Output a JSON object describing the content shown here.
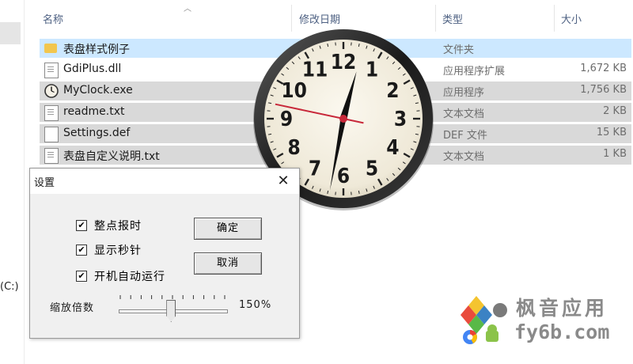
{
  "explorer": {
    "columns": {
      "name": "名称",
      "modified": "修改日期",
      "type": "类型",
      "size": "大小"
    },
    "rows": [
      {
        "name": "表盘样式例子",
        "type": "文件夹",
        "size": "",
        "icon": "folder-icon"
      },
      {
        "name": "GdiPlus.dll",
        "type": "应用程序扩展",
        "size": "1,672 KB",
        "icon": "dll-file-icon"
      },
      {
        "name": "MyClock.exe",
        "type": "应用程序",
        "size": "1,756 KB",
        "icon": "clock-app-icon"
      },
      {
        "name": "readme.txt",
        "type": "文本文档",
        "size": "2 KB",
        "icon": "text-file-icon"
      },
      {
        "name": "Settings.def",
        "type": "DEF 文件",
        "size": "15 KB",
        "icon": "generic-file-icon"
      },
      {
        "name": "表盘自定义说明.txt",
        "type": "文本文档",
        "size": "1 KB",
        "icon": "text-file-icon"
      }
    ],
    "nav_drive_label": "(C:)"
  },
  "clock": {
    "numerals": [
      "12",
      "1",
      "2",
      "3",
      "4",
      "5",
      "6",
      "7",
      "8",
      "9",
      "10",
      "11"
    ],
    "time": {
      "hour": 12,
      "minute": 31,
      "second": 47
    }
  },
  "settings_dialog": {
    "title": "设置",
    "close_glyph": "✕",
    "options": [
      {
        "label": "整点报时",
        "checked": true
      },
      {
        "label": "显示秒针",
        "checked": true
      },
      {
        "label": "开机自动运行",
        "checked": true
      }
    ],
    "ok_label": "确定",
    "cancel_label": "取消",
    "zoom_label": "缩放倍数",
    "zoom_value": "150%",
    "zoom_fraction": 0.48
  },
  "watermark": {
    "cn": "枫音应用",
    "url": "fy6b.com"
  },
  "colors": {
    "selection": "#cce8ff",
    "highlight": "#d9d9d9",
    "second_hand": "#c8283a",
    "header_text": "#4d6082"
  }
}
